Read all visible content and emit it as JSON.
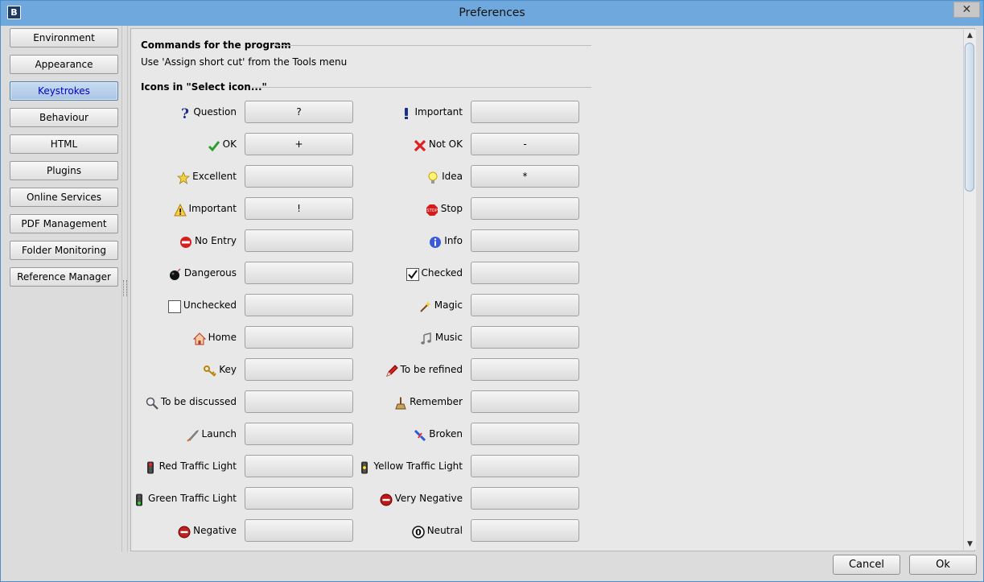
{
  "window": {
    "title": "Preferences",
    "app_icon_glyph": "B",
    "close_glyph": "✕"
  },
  "sidebar": {
    "items": [
      {
        "label": "Environment",
        "active": false
      },
      {
        "label": "Appearance",
        "active": false
      },
      {
        "label": "Keystrokes",
        "active": true
      },
      {
        "label": "Behaviour",
        "active": false
      },
      {
        "label": "HTML",
        "active": false
      },
      {
        "label": "Plugins",
        "active": false
      },
      {
        "label": "Online Services",
        "active": false
      },
      {
        "label": "PDF Management",
        "active": false
      },
      {
        "label": "Folder Monitoring",
        "active": false
      },
      {
        "label": "Reference Manager",
        "active": false
      }
    ]
  },
  "content": {
    "commands_header": "Commands for the program",
    "commands_note": "Use 'Assign short cut' from the Tools menu",
    "icons_header": "Icons in \"Select icon...\"",
    "left": [
      {
        "label": "Question",
        "key": "?",
        "icon": "question-icon"
      },
      {
        "label": "OK",
        "key": "+",
        "icon": "check-icon"
      },
      {
        "label": "Excellent",
        "key": "",
        "icon": "star-icon"
      },
      {
        "label": "Important",
        "key": "!",
        "icon": "warning-icon"
      },
      {
        "label": "No Entry",
        "key": "",
        "icon": "no-entry-icon"
      },
      {
        "label": "Dangerous",
        "key": "",
        "icon": "bomb-icon"
      },
      {
        "label": "Unchecked",
        "key": "",
        "icon": "unchecked-box-icon"
      },
      {
        "label": "Home",
        "key": "",
        "icon": "home-icon"
      },
      {
        "label": "Key",
        "key": "",
        "icon": "key-icon"
      },
      {
        "label": "To be discussed",
        "key": "",
        "icon": "magnifier-icon"
      },
      {
        "label": "Launch",
        "key": "",
        "icon": "rocket-icon"
      },
      {
        "label": "Red Traffic Light",
        "key": "",
        "icon": "red-traffic-light-icon"
      },
      {
        "label": "Green Traffic Light",
        "key": "",
        "icon": "green-traffic-light-icon"
      },
      {
        "label": "Negative",
        "key": "",
        "icon": "minus-circle-icon"
      }
    ],
    "right": [
      {
        "label": "Important",
        "key": "",
        "icon": "exclamation-icon"
      },
      {
        "label": "Not OK",
        "key": "-",
        "icon": "cross-icon"
      },
      {
        "label": "Idea",
        "key": "*",
        "icon": "lightbulb-icon"
      },
      {
        "label": "Stop",
        "key": "",
        "icon": "stop-sign-icon"
      },
      {
        "label": "Info",
        "key": "",
        "icon": "info-icon"
      },
      {
        "label": "Checked",
        "key": "",
        "icon": "checked-box-icon"
      },
      {
        "label": "Magic",
        "key": "",
        "icon": "magic-wand-icon"
      },
      {
        "label": "Music",
        "key": "",
        "icon": "music-icon"
      },
      {
        "label": "To be refined",
        "key": "",
        "icon": "pencil-icon"
      },
      {
        "label": "Remember",
        "key": "",
        "icon": "broom-icon"
      },
      {
        "label": "Broken",
        "key": "",
        "icon": "broken-icon"
      },
      {
        "label": "Yellow Traffic Light",
        "key": "",
        "icon": "yellow-traffic-light-icon"
      },
      {
        "label": "Very Negative",
        "key": "",
        "icon": "double-minus-circle-icon"
      },
      {
        "label": "Neutral",
        "key": "",
        "icon": "zero-circle-icon"
      }
    ]
  },
  "footer": {
    "cancel_label": "Cancel",
    "ok_label": "Ok"
  },
  "scrollbar": {
    "up_glyph": "▲",
    "down_glyph": "▼"
  }
}
